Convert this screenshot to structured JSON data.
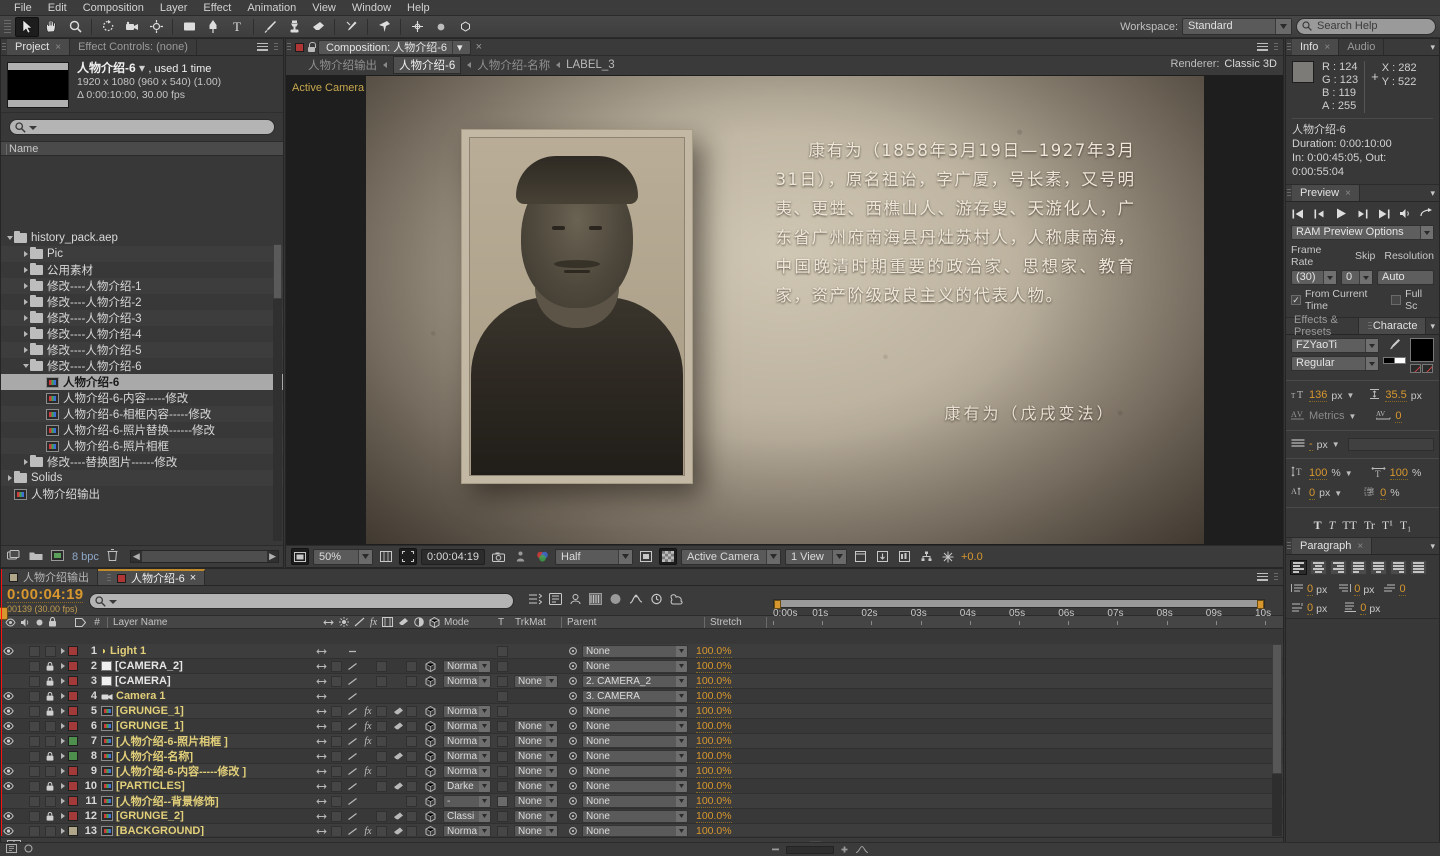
{
  "menu": {
    "items": [
      "File",
      "Edit",
      "Composition",
      "Layer",
      "Effect",
      "Animation",
      "View",
      "Window",
      "Help"
    ]
  },
  "toolbar": {
    "workspace_label": "Workspace:",
    "workspace_value": "Standard",
    "search_help_placeholder": "Search Help"
  },
  "project": {
    "tabs": [
      {
        "label": "Project",
        "active": true,
        "closable": true
      },
      {
        "label": "Effect Controls: (none)",
        "active": false,
        "closable": false
      }
    ],
    "header": {
      "name": "人物介绍-6",
      "used": ", used 1 time",
      "dimensions": "1920 x 1080  (960 x 540) (1.00)",
      "duration": "Δ 0:00:10:00, 30.00 fps"
    },
    "search_placeholder": "",
    "column_header": "Name",
    "tree": [
      {
        "label": "history_pack.aep",
        "depth": 0,
        "type": "folder",
        "twist": "down",
        "selected": false
      },
      {
        "label": "Pic",
        "depth": 1,
        "type": "folder",
        "twist": "right",
        "selected": false
      },
      {
        "label": "公用素材",
        "depth": 1,
        "type": "folder",
        "twist": "right",
        "selected": false
      },
      {
        "label": "修改----人物介绍-1",
        "depth": 1,
        "type": "folder",
        "twist": "right",
        "selected": false
      },
      {
        "label": "修改----人物介绍-2",
        "depth": 1,
        "type": "folder",
        "twist": "right",
        "selected": false
      },
      {
        "label": "修改----人物介绍-3",
        "depth": 1,
        "type": "folder",
        "twist": "right",
        "selected": false
      },
      {
        "label": "修改----人物介绍-4",
        "depth": 1,
        "type": "folder",
        "twist": "right",
        "selected": false
      },
      {
        "label": "修改----人物介绍-5",
        "depth": 1,
        "type": "folder",
        "twist": "right",
        "selected": false
      },
      {
        "label": "修改----人物介绍-6",
        "depth": 1,
        "type": "folder",
        "twist": "down",
        "selected": false
      },
      {
        "label": "人物介绍-6",
        "depth": 2,
        "type": "comp",
        "twist": "none",
        "selected": true
      },
      {
        "label": "人物介绍-6-内容-----修改",
        "depth": 2,
        "type": "comp",
        "twist": "none",
        "selected": false
      },
      {
        "label": "人物介绍-6-相框内容-----修改",
        "depth": 2,
        "type": "comp",
        "twist": "none",
        "selected": false
      },
      {
        "label": "人物介绍-6-照片替换------修改",
        "depth": 2,
        "type": "comp",
        "twist": "none",
        "selected": false
      },
      {
        "label": "人物介绍-6-照片相框",
        "depth": 2,
        "type": "comp",
        "twist": "none",
        "selected": false
      },
      {
        "label": "修改----替换图片------修改",
        "depth": 1,
        "type": "folder",
        "twist": "right",
        "selected": false
      },
      {
        "label": "Solids",
        "depth": 0,
        "type": "folder",
        "twist": "right",
        "selected": false
      },
      {
        "label": "人物介绍输出",
        "depth": 0,
        "type": "comp",
        "twist": "none",
        "selected": false
      }
    ],
    "footer": {
      "bpc": "8 bpc"
    }
  },
  "composition": {
    "tab_label": "Composition: 人物介绍-6",
    "breadcrumbs": [
      {
        "label": "人物介绍输出",
        "current": false
      },
      {
        "label": "人物介绍-6",
        "current": true
      },
      {
        "label": "人物介绍-名称",
        "current": false
      },
      {
        "label": "LABEL_3",
        "current": false
      }
    ],
    "renderer_label": "Renderer:",
    "renderer_value": "Classic 3D",
    "active_camera_badge": "Active Camera",
    "stage": {
      "body_text": "康有为（1858年3月19日—1927年3月31日），原名祖诒，字广厦，号长素，又号明夷、更甡、西樵山人、游存叟、天游化人，广东省广州府南海县丹灶苏村人，人称康南海，中国晚清时期重要的政治家、思想家、教育家，资产阶级改良主义的代表人物。",
      "caption": "康有为（戊戌变法）"
    },
    "footer": {
      "zoom": "50%",
      "timecode": "0:00:04:19",
      "resolution": "Half",
      "view_camera": "Active Camera",
      "view_layout": "1 View",
      "exposure": "+0.0"
    }
  },
  "info_panel": {
    "tabs": [
      {
        "label": "Info",
        "active": true
      },
      {
        "label": "Audio",
        "active": false
      }
    ],
    "color": {
      "r_label": "R :",
      "r": "124",
      "g_label": "G :",
      "g": "123",
      "b_label": "B :",
      "b": "119",
      "a_label": "A :",
      "a": "255",
      "swatch": "#7c7b77"
    },
    "position": {
      "x_label": "X :",
      "x": "282",
      "y_label": "Y :",
      "y": "522"
    },
    "comp_name": "人物介绍-6",
    "duration": "Duration: 0:00:10:00",
    "inout": "In: 0:00:45:05, Out: 0:00:55:04"
  },
  "preview_panel": {
    "tab": "Preview",
    "options_label": "RAM Preview Options",
    "frame_rate_label": "Frame Rate",
    "frame_rate_value": "(30)",
    "skip_label": "Skip",
    "skip_value": "0",
    "resolution_label": "Resolution",
    "resolution_value": "Auto",
    "from_current_time": "From Current Time",
    "full_screen": "Full Sc"
  },
  "character_panel": {
    "tabs": [
      {
        "label": "Effects & Presets",
        "active": false
      },
      {
        "label": "Characte",
        "active": true
      }
    ],
    "font_family": "FZYaoTi",
    "font_style": "Regular",
    "font_size": "136",
    "font_size_unit": "px",
    "leading": "35.5",
    "leading_unit": "px",
    "kerning": "Metrics",
    "tracking": "0",
    "stroke_width": "-",
    "stroke_unit": "px",
    "vertical_scale": "100",
    "horizontal_scale": "100",
    "baseline_shift": "0",
    "tsume": "0",
    "style_buttons": [
      "T",
      "T",
      "TT",
      "Tr",
      "T¹",
      "T₁"
    ]
  },
  "paragraph_panel": {
    "tab": "Paragraph",
    "indent_left": "0",
    "indent_right": "0",
    "indent_first": "0",
    "space_before": "0",
    "space_after": "0",
    "unit": "px"
  },
  "timeline": {
    "tabs": [
      {
        "label": "人物介绍输出",
        "active": false,
        "color": "#b0a68a"
      },
      {
        "label": "人物介绍-6",
        "active": true,
        "color": "#b03535"
      }
    ],
    "timecode": "0:00:04:19",
    "frame_info": "00139 (30.00 fps)",
    "search_placeholder": "",
    "columns": [
      "Layer Name",
      "Mode",
      "T",
      "TrkMat",
      "Parent",
      "Stretch"
    ],
    "ruler_ticks": [
      "0:00s",
      "01s",
      "02s",
      "03s",
      "04s",
      "05s",
      "06s",
      "07s",
      "08s",
      "09s",
      "10s"
    ],
    "playhead_time": "0:00:04:19",
    "layers": [
      {
        "num": "1",
        "name": "Light 1",
        "type": "light",
        "label": "#a33a3a",
        "eye": true,
        "lock": false,
        "mode": "",
        "trkmat": "",
        "parent": "None",
        "stretch": "100.0%",
        "bar_color": "#8d3838",
        "bar_start": 0,
        "bar_end": 100
      },
      {
        "num": "2",
        "name": "[CAMERA_2]",
        "type": "solid",
        "label": "#a33a3a",
        "eye": false,
        "lock": true,
        "mode": "Norma",
        "trkmat": "",
        "parent": "None",
        "stretch": "100.0%",
        "bar_color": "#8d3838",
        "bar_start": 0,
        "bar_end": 96
      },
      {
        "num": "3",
        "name": "[CAMERA]",
        "type": "solid",
        "label": "#a33a3a",
        "eye": false,
        "lock": true,
        "mode": "Norma",
        "trkmat": "None",
        "parent": "2. CAMERA_2",
        "stretch": "100.0%",
        "bar_color": "#8d3838",
        "bar_start": 0,
        "bar_end": 96
      },
      {
        "num": "4",
        "name": "Camera 1",
        "type": "camera",
        "label": "#a33a3a",
        "eye": true,
        "lock": true,
        "mode": "",
        "trkmat": "",
        "parent": "3. CAMERA",
        "stretch": "100.0%",
        "bar_color": "#8d3838",
        "bar_start": 0,
        "bar_end": 96
      },
      {
        "num": "5",
        "name": "[GRUNGE_1]",
        "type": "comp",
        "label": "#a33a3a",
        "eye": true,
        "lock": true,
        "mode": "Norma",
        "trkmat": "",
        "parent": "None",
        "stretch": "100.0%",
        "bar_color": "#8d3838",
        "bar_start": 0,
        "bar_end": 100
      },
      {
        "num": "6",
        "name": "[GRUNGE_1]",
        "type": "comp",
        "label": "#a33a3a",
        "eye": true,
        "lock": false,
        "mode": "Norma",
        "trkmat": "None",
        "parent": "None",
        "stretch": "100.0%",
        "bar_color": "#8d3838",
        "bar_start": 0,
        "bar_end": 100
      },
      {
        "num": "7",
        "name": "[人物介绍-6-照片相框 ]",
        "type": "comp",
        "label": "#4e8f4e",
        "eye": true,
        "lock": false,
        "mode": "Norma",
        "trkmat": "None",
        "parent": "None",
        "stretch": "100.0%",
        "bar_color": "#45843f",
        "bar_start": 0,
        "bar_end": 100
      },
      {
        "num": "8",
        "name": "[人物介绍-名称]",
        "type": "comp",
        "label": "#4e8f4e",
        "eye": false,
        "lock": true,
        "mode": "Norma",
        "trkmat": "None",
        "parent": "None",
        "stretch": "100.0%",
        "bar_color": "#45843f",
        "bar_start": 0,
        "bar_end": 100
      },
      {
        "num": "9",
        "name": "[人物介绍-6-内容-----修改 ]",
        "type": "comp",
        "label": "#a33a3a",
        "eye": true,
        "lock": false,
        "mode": "Norma",
        "trkmat": "None",
        "parent": "None",
        "stretch": "100.0%",
        "bar_color": "#8d3838",
        "bar_start": 10,
        "bar_end": 100
      },
      {
        "num": "10",
        "name": "[PARTICLES]",
        "type": "comp",
        "label": "#a33a3a",
        "eye": true,
        "lock": true,
        "mode": "Darke",
        "trkmat": "None",
        "parent": "None",
        "stretch": "100.0%",
        "bar_color": "#8d3838",
        "bar_start": 0,
        "bar_end": 100
      },
      {
        "num": "11",
        "name": "[人物介绍--背景修饰]",
        "type": "comp",
        "label": "#a33a3a",
        "eye": false,
        "lock": false,
        "mode": "-",
        "trkmat": "None",
        "parent": "None",
        "stretch": "100.0%",
        "bar_color": "#8d3838",
        "bar_start": 0,
        "bar_end": 100
      },
      {
        "num": "12",
        "name": "[GRUNGE_2]",
        "type": "comp",
        "label": "#a33a3a",
        "eye": true,
        "lock": true,
        "mode": "Classi",
        "trkmat": "None",
        "parent": "None",
        "stretch": "100.0%",
        "bar_color": "#8d3838",
        "bar_start": 0,
        "bar_end": 100
      },
      {
        "num": "13",
        "name": "[BACKGROUND]",
        "type": "comp",
        "label": "#b0a68a",
        "eye": true,
        "lock": false,
        "mode": "Norma",
        "trkmat": "None",
        "parent": "None",
        "stretch": "100.0%",
        "bar_color": "#8a7f63",
        "bar_start": 0,
        "bar_end": 100
      }
    ]
  }
}
